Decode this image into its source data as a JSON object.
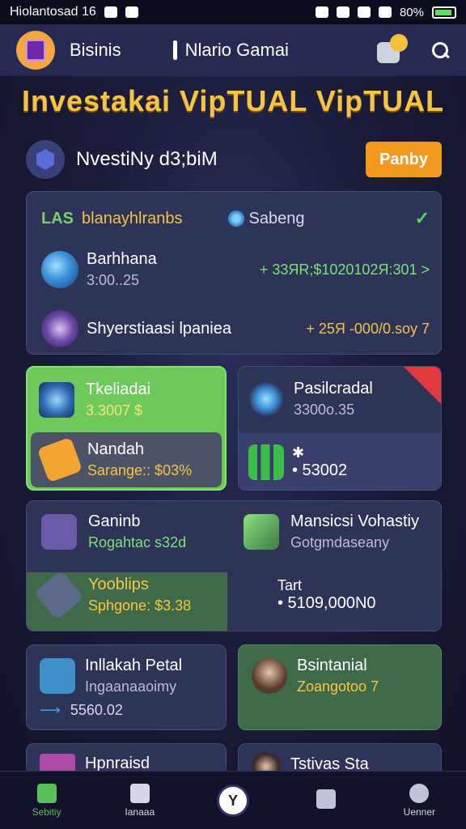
{
  "status": {
    "left_text": "Hiolantosad 16",
    "battery": "80%"
  },
  "appbar": {
    "brand": "Bisinis",
    "center_title": "Nlario Gamai"
  },
  "headline": "Investakai VipTUAL VipTUAL",
  "banner": {
    "title": "NvestiNy d3;biM",
    "button": "Panby"
  },
  "card1": {
    "tag": "LAS",
    "title": "blanayhlranbs",
    "status": "Sabeng",
    "check": "✓",
    "rows": [
      {
        "name": "Barhhana",
        "sub": "3:00..25",
        "value": "+ 33ЯR;$1020102Я:301 >"
      },
      {
        "name": "Shyerstiaasi lpaniea",
        "sub": "",
        "value": "+ 25Я -000/0.soy 7"
      }
    ]
  },
  "tiles": {
    "t1": {
      "name": "Tkeliadai",
      "value": "3.3007 $"
    },
    "t1b": {
      "name": "Nandah",
      "value": "Sarange:: $03%"
    },
    "t2": {
      "name": "Pasilcradal",
      "value": "3300o.35",
      "extra": "✱",
      "amount": "• 53002"
    },
    "t3": {
      "name": "Ganinb",
      "value": "Rogahtac s32d"
    },
    "t3b": {
      "name": "Yooblips",
      "value": "Sphgone: $3.38"
    },
    "t4": {
      "name": "Mansicsi Vohastiy",
      "value": "Gotgmdaseany",
      "extra": "Tart",
      "amount": "• 5109,000N0"
    },
    "t5": {
      "name": "Inllakah Petal",
      "value": "Ingaanaaoimy",
      "amount": "5560.02"
    },
    "t6": {
      "name": "Bsintanial",
      "value": "Zoangotoo 7"
    },
    "t7": {
      "name": "Hpnraisd"
    },
    "t8": {
      "name": "Tstivas Sta"
    }
  },
  "colors": {
    "accent_orange": "#f39a1e",
    "green": "#6cc95a",
    "gold": "#f5c542"
  },
  "nav": [
    {
      "label": "Sebitiy",
      "icon": "home-icon"
    },
    {
      "label": "Ianaaa",
      "icon": "check-box-icon"
    },
    {
      "label": "",
      "icon": "center-icon"
    },
    {
      "label": "",
      "icon": "list-icon"
    },
    {
      "label": "Uenner",
      "icon": "user-icon"
    }
  ]
}
